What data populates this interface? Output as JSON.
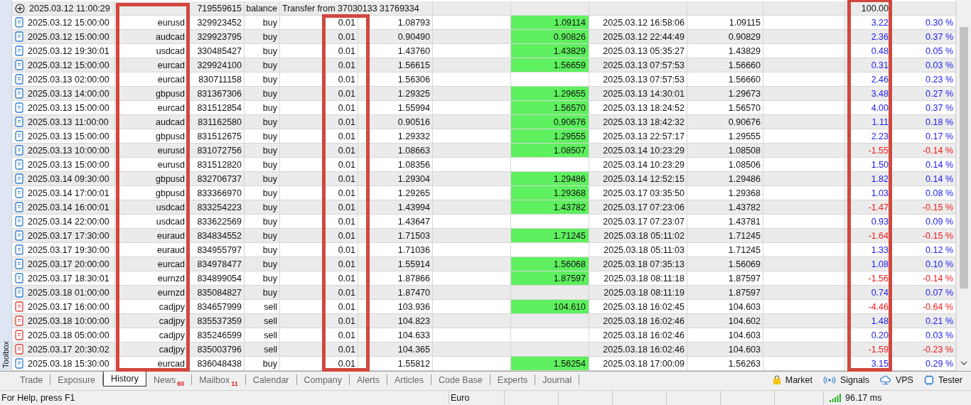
{
  "toolbox_label": "Toolbox",
  "balance": {
    "time": "2025.03.12 11:00:29",
    "ticket": "719559615",
    "type": "balance",
    "comment": "Transfer from 37030133 31769334",
    "profit": "100.00"
  },
  "deals": [
    {
      "time": "2025.03.12 15:00:00",
      "symbol": "eurusd",
      "ticket": "329923452",
      "type": "buy",
      "kind": "buy",
      "volume": "0.01",
      "price": "1.08793",
      "tp": "1.09114",
      "close_time": "2025.03.12 16:58:06",
      "close_price": "1.09115",
      "profit": "3.22",
      "percent": "0.30 %",
      "loss": false
    },
    {
      "time": "2025.03.12 15:00:00",
      "symbol": "audcad",
      "ticket": "329923795",
      "type": "buy",
      "kind": "buy",
      "volume": "0.01",
      "price": "0.90490",
      "tp": "0.90826",
      "close_time": "2025.03.12 22:44:49",
      "close_price": "0.90829",
      "profit": "2.36",
      "percent": "0.37 %",
      "loss": false
    },
    {
      "time": "2025.03.12 19:30:01",
      "symbol": "usdcad",
      "ticket": "330485427",
      "type": "buy",
      "kind": "buy",
      "volume": "0.01",
      "price": "1.43760",
      "tp": "1.43829",
      "close_time": "2025.03.13 05:35:27",
      "close_price": "1.43829",
      "profit": "0.48",
      "percent": "0.05 %",
      "loss": false
    },
    {
      "time": "2025.03.12 15:00:00",
      "symbol": "eurcad",
      "ticket": "329924100",
      "type": "buy",
      "kind": "buy",
      "volume": "0.01",
      "price": "1.56615",
      "tp": "1.56659",
      "close_time": "2025.03.13 07:57:53",
      "close_price": "1.56660",
      "profit": "0.31",
      "percent": "0.03 %",
      "loss": false
    },
    {
      "time": "2025.03.13 02:00:00",
      "symbol": "eurcad",
      "ticket": "830711158",
      "type": "buy",
      "kind": "buy",
      "volume": "0.01",
      "price": "1.56306",
      "close_time": "2025.03.13 07:57:53",
      "close_price": "1.56660",
      "profit": "2.46",
      "percent": "0.23 %",
      "loss": false
    },
    {
      "time": "2025.03.13 14:00:00",
      "symbol": "gbpusd",
      "ticket": "831367306",
      "type": "buy",
      "kind": "buy",
      "volume": "0.01",
      "price": "1.29325",
      "tp": "1.29655",
      "close_time": "2025.03.13 14:30:01",
      "close_price": "1.29673",
      "profit": "3.48",
      "percent": "0.27 %",
      "loss": false
    },
    {
      "time": "2025.03.13 15:00:00",
      "symbol": "eurcad",
      "ticket": "831512854",
      "type": "buy",
      "kind": "buy",
      "volume": "0.01",
      "price": "1.55994",
      "tp": "1.56570",
      "close_time": "2025.03.13 18:24:52",
      "close_price": "1.56570",
      "profit": "4.00",
      "percent": "0.37 %",
      "loss": false
    },
    {
      "time": "2025.03.13 11:00:00",
      "symbol": "audcad",
      "ticket": "831162580",
      "type": "buy",
      "kind": "buy",
      "volume": "0.01",
      "price": "0.90516",
      "tp": "0.90676",
      "close_time": "2025.03.13 18:42:32",
      "close_price": "0.90676",
      "profit": "1.11",
      "percent": "0.18 %",
      "loss": false
    },
    {
      "time": "2025.03.13 15:00:00",
      "symbol": "gbpusd",
      "ticket": "831512675",
      "type": "buy",
      "kind": "buy",
      "volume": "0.01",
      "price": "1.29332",
      "tp": "1.29555",
      "close_time": "2025.03.13 22:57:17",
      "close_price": "1.29555",
      "profit": "2.23",
      "percent": "0.17 %",
      "loss": false
    },
    {
      "time": "2025.03.13 10:00:00",
      "symbol": "eurusd",
      "ticket": "831072756",
      "type": "buy",
      "kind": "buy",
      "volume": "0.01",
      "price": "1.08663",
      "tp": "1.08507",
      "close_time": "2025.03.14 10:23:29",
      "close_price": "1.08508",
      "profit": "-1.55",
      "percent": "-0.14 %",
      "loss": true
    },
    {
      "time": "2025.03.13 15:00:00",
      "symbol": "eurusd",
      "ticket": "831512820",
      "type": "buy",
      "kind": "buy",
      "volume": "0.01",
      "price": "1.08356",
      "close_time": "2025.03.14 10:23:29",
      "close_price": "1.08506",
      "profit": "1.50",
      "percent": "0.14 %",
      "loss": false
    },
    {
      "time": "2025.03.14 09:30:00",
      "symbol": "gbpusd",
      "ticket": "832706737",
      "type": "buy",
      "kind": "buy",
      "volume": "0.01",
      "price": "1.29304",
      "tp": "1.29486",
      "close_time": "2025.03.14 12:52:15",
      "close_price": "1.29486",
      "profit": "1.82",
      "percent": "0.14 %",
      "loss": false
    },
    {
      "time": "2025.03.14 17:00:01",
      "symbol": "gbpusd",
      "ticket": "833366970",
      "type": "buy",
      "kind": "buy",
      "volume": "0.01",
      "price": "1.29265",
      "tp": "1.29368",
      "close_time": "2025.03.17 03:35:50",
      "close_price": "1.29368",
      "profit": "1.03",
      "percent": "0.08 %",
      "loss": false
    },
    {
      "time": "2025.03.14 16:00:01",
      "symbol": "usdcad",
      "ticket": "833254223",
      "type": "buy",
      "kind": "buy",
      "volume": "0.01",
      "price": "1.43994",
      "tp": "1.43782",
      "close_time": "2025.03.17 07:23:06",
      "close_price": "1.43782",
      "profit": "-1.47",
      "percent": "-0.15 %",
      "loss": true
    },
    {
      "time": "2025.03.14 22:00:00",
      "symbol": "usdcad",
      "ticket": "833622569",
      "type": "buy",
      "kind": "buy",
      "volume": "0.01",
      "price": "1.43647",
      "close_time": "2025.03.17 07:23:07",
      "close_price": "1.43781",
      "profit": "0.93",
      "percent": "0.09 %",
      "loss": false
    },
    {
      "time": "2025.03.17 17:30:00",
      "symbol": "euraud",
      "ticket": "834834552",
      "type": "buy",
      "kind": "buy",
      "volume": "0.01",
      "price": "1.71503",
      "tp": "1.71245",
      "close_time": "2025.03.18 05:11:02",
      "close_price": "1.71245",
      "profit": "-1.64",
      "percent": "-0.15 %",
      "loss": true
    },
    {
      "time": "2025.03.17 19:30:00",
      "symbol": "euraud",
      "ticket": "834955797",
      "type": "buy",
      "kind": "buy",
      "volume": "0.01",
      "price": "1.71036",
      "close_time": "2025.03.18 05:11:03",
      "close_price": "1.71245",
      "profit": "1.33",
      "percent": "0.12 %",
      "loss": false
    },
    {
      "time": "2025.03.17 20:00:00",
      "symbol": "eurcad",
      "ticket": "834978477",
      "type": "buy",
      "kind": "buy",
      "volume": "0.01",
      "price": "1.55914",
      "tp": "1.56068",
      "close_time": "2025.03.18 07:35:13",
      "close_price": "1.56069",
      "profit": "1.08",
      "percent": "0.10 %",
      "loss": false
    },
    {
      "time": "2025.03.17 18:30:01",
      "symbol": "eurnzd",
      "ticket": "834899054",
      "type": "buy",
      "kind": "buy",
      "volume": "0.01",
      "price": "1.87866",
      "tp": "1.87597",
      "close_time": "2025.03.18 08:11:18",
      "close_price": "1.87597",
      "profit": "-1.56",
      "percent": "-0.14 %",
      "loss": true
    },
    {
      "time": "2025.03.18 01:00:00",
      "symbol": "eurnzd",
      "ticket": "835084827",
      "type": "buy",
      "kind": "buy",
      "volume": "0.01",
      "price": "1.87470",
      "close_time": "2025.03.18 08:11:19",
      "close_price": "1.87597",
      "profit": "0.74",
      "percent": "0.07 %",
      "loss": false
    },
    {
      "time": "2025.03.17 16:00:00",
      "symbol": "cadjpy",
      "ticket": "834657999",
      "type": "sell",
      "kind": "sell",
      "volume": "0.01",
      "price": "103.936",
      "tp": "104.610",
      "close_time": "2025.03.18 16:02:45",
      "close_price": "104.603",
      "profit": "-4.46",
      "percent": "-0.64 %",
      "loss": true
    },
    {
      "time": "2025.03.18 10:00:00",
      "symbol": "cadjpy",
      "ticket": "835537359",
      "type": "sell",
      "kind": "sell",
      "volume": "0.01",
      "price": "104.823",
      "close_time": "2025.03.18 16:02:46",
      "close_price": "104.602",
      "profit": "1.48",
      "percent": "0.21 %",
      "loss": false
    },
    {
      "time": "2025.03.18 05:00:00",
      "symbol": "cadjpy",
      "ticket": "835246599",
      "type": "sell",
      "kind": "sell",
      "volume": "0.01",
      "price": "104.633",
      "close_time": "2025.03.18 16:02:46",
      "close_price": "104.603",
      "profit": "0.20",
      "percent": "0.03 %",
      "loss": false
    },
    {
      "time": "2025.03.17 20:30:02",
      "symbol": "cadjpy",
      "ticket": "835003796",
      "type": "sell",
      "kind": "sell",
      "volume": "0.01",
      "price": "104.365",
      "close_time": "2025.03.18 16:02:46",
      "close_price": "104.603",
      "profit": "-1.59",
      "percent": "-0.23 %",
      "loss": true
    },
    {
      "time": "2025.03.18 15:30:00",
      "symbol": "eurcad",
      "ticket": "836048438",
      "type": "buy",
      "kind": "buy",
      "volume": "0.01",
      "price": "1.55812",
      "tp": "1.56254",
      "close_time": "2025.03.18 17:00:09",
      "close_price": "1.56263",
      "profit": "3.15",
      "percent": "0.29 %",
      "loss": false
    }
  ],
  "tabs": [
    {
      "label": "Trade",
      "selected": false
    },
    {
      "label": "Exposure",
      "selected": false
    },
    {
      "label": "History",
      "selected": true
    },
    {
      "label": "News",
      "selected": false,
      "badge": "60"
    },
    {
      "label": "Mailbox",
      "selected": false,
      "badge": "11"
    },
    {
      "label": "Calendar",
      "selected": false
    },
    {
      "label": "Company",
      "selected": false
    },
    {
      "label": "Alerts",
      "selected": false
    },
    {
      "label": "Articles",
      "selected": false
    },
    {
      "label": "Code Base",
      "selected": false
    },
    {
      "label": "Experts",
      "selected": false
    },
    {
      "label": "Journal",
      "selected": false
    }
  ],
  "tools": [
    {
      "label": "Market",
      "kind": "market"
    },
    {
      "label": "Signals",
      "kind": "signals"
    },
    {
      "label": "VPS",
      "kind": "vps"
    },
    {
      "label": "Tester",
      "kind": "tester"
    }
  ],
  "status_bar": {
    "help": "For Help, press F1",
    "currency": "Euro",
    "ping": "96.17 ms"
  }
}
